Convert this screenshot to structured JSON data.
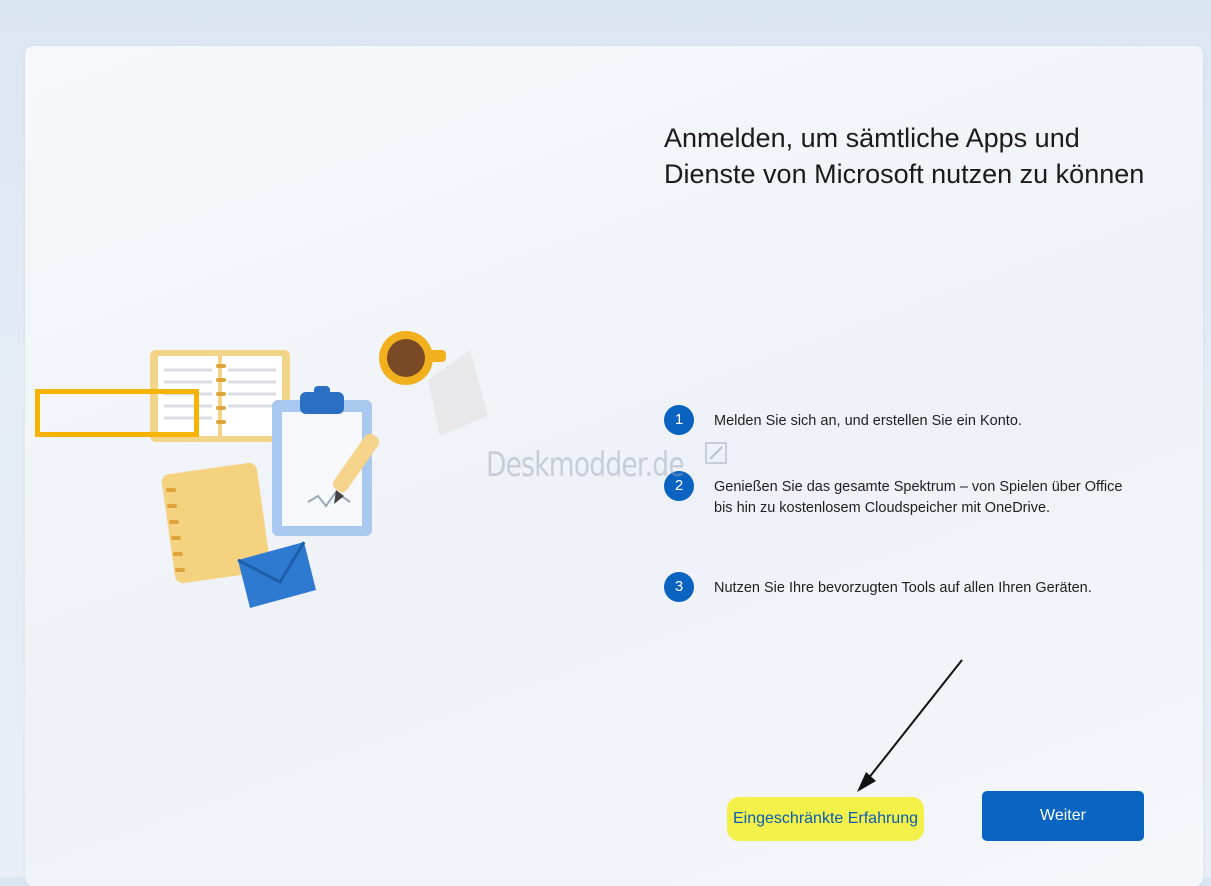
{
  "title": "Anmelden, um sämtliche Apps und Dienste von Microsoft nutzen zu können",
  "steps": [
    {
      "num": "1",
      "text": "Melden Sie sich an, und erstellen Sie ein Konto."
    },
    {
      "num": "2",
      "text": "Genießen Sie das gesamte Spektrum – von Spielen über Office bis hin zu kostenlosem Cloudspeicher mit OneDrive."
    },
    {
      "num": "3",
      "text": "Nutzen Sie Ihre bevorzugten Tools auf allen Ihren Geräten."
    }
  ],
  "watermark": "Deskmodder.de",
  "buttons": {
    "limited": "Eingeschränkte Erfahrung",
    "next": "Weiter"
  },
  "colors": {
    "accent": "#0a64c2",
    "highlight_marker": "#f3f04a",
    "highlight_box": "#f6b400"
  }
}
